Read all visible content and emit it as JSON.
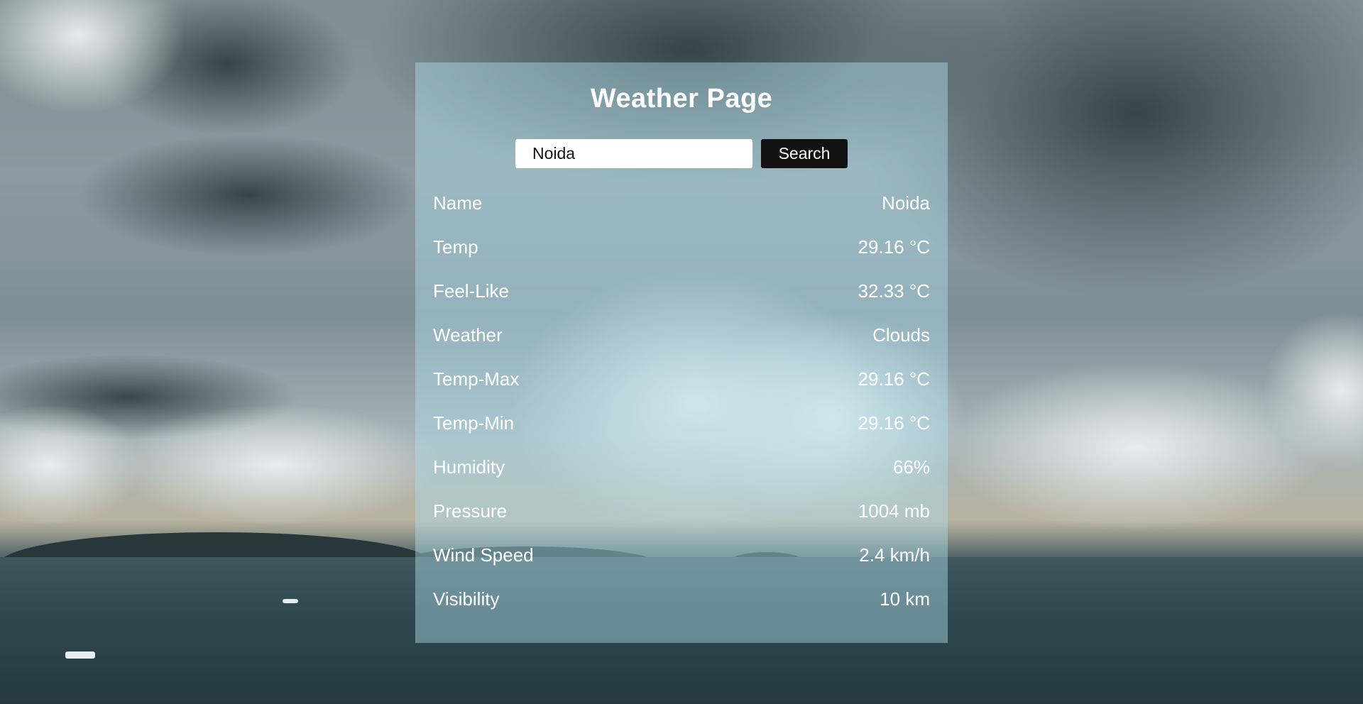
{
  "title": "Weather Page",
  "search": {
    "value": "Noida",
    "placeholder": "",
    "button_label": "Search"
  },
  "rows": [
    {
      "label": "Name",
      "value": "Noida"
    },
    {
      "label": "Temp",
      "value": "29.16 °C"
    },
    {
      "label": "Feel-Like",
      "value": "32.33 °C"
    },
    {
      "label": "Weather",
      "value": "Clouds"
    },
    {
      "label": "Temp-Max",
      "value": "29.16 °C"
    },
    {
      "label": "Temp-Min",
      "value": "29.16 °C"
    },
    {
      "label": "Humidity",
      "value": "66%"
    },
    {
      "label": "Pressure",
      "value": "1004 mb"
    },
    {
      "label": "Wind Speed",
      "value": "2.4 km/h"
    },
    {
      "label": "Visibility",
      "value": "10 km"
    }
  ],
  "colors": {
    "panel": "#afdeec",
    "button": "#111111",
    "text": "#ffffff"
  }
}
